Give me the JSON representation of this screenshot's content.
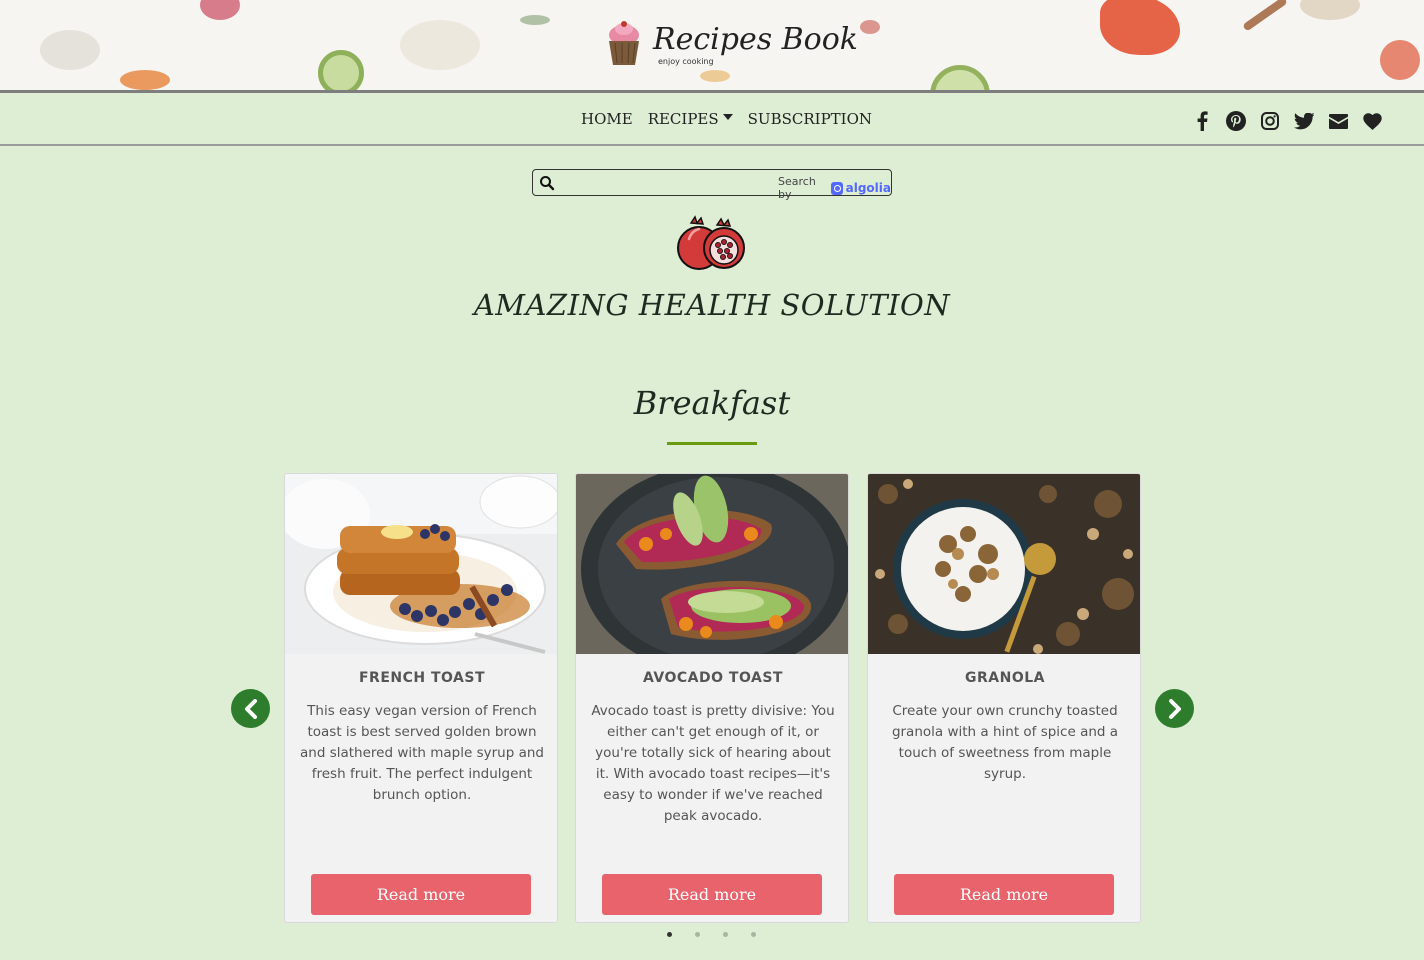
{
  "brand": {
    "title": "Recipes Book",
    "tagline": "enjoy cooking"
  },
  "nav": {
    "links": [
      {
        "label": "Home"
      },
      {
        "label": "Recipes"
      },
      {
        "label": "Subscription"
      }
    ],
    "social_icons": [
      "facebook-icon",
      "pinterest-icon",
      "instagram-icon",
      "twitter-icon",
      "envelope-icon",
      "heart-icon"
    ]
  },
  "search": {
    "placeholder": "",
    "powered_prefix": "Search by",
    "powered_brand": "algolia"
  },
  "hero": {
    "title": "AMAZING HEALTH SOLUTION"
  },
  "section": {
    "title": "Breakfast"
  },
  "cards": [
    {
      "title": "French Toast",
      "description": "This easy vegan version of French toast is best served golden brown and slathered with maple syrup and fresh fruit. The perfect indulgent brunch option.",
      "button": "Read more"
    },
    {
      "title": "Avocado Toast",
      "description": "Avocado toast is pretty divisive: You either can't get enough of it, or you're totally sick of hearing about it. With avocado toast recipes—it's easy to wonder if we've reached peak avocado.",
      "button": "Read more"
    },
    {
      "title": "Granola",
      "description": "Create your own crunchy toasted granola with a hint of spice and a touch of sweetness from maple syrup.",
      "button": "Read more"
    }
  ],
  "carousel": {
    "active_page": 1,
    "page_count": 4
  },
  "colors": {
    "background": "#ddeed5",
    "accent_rule": "#6a9a10",
    "button": "#e8636b",
    "arrow": "#2e7d2c"
  }
}
